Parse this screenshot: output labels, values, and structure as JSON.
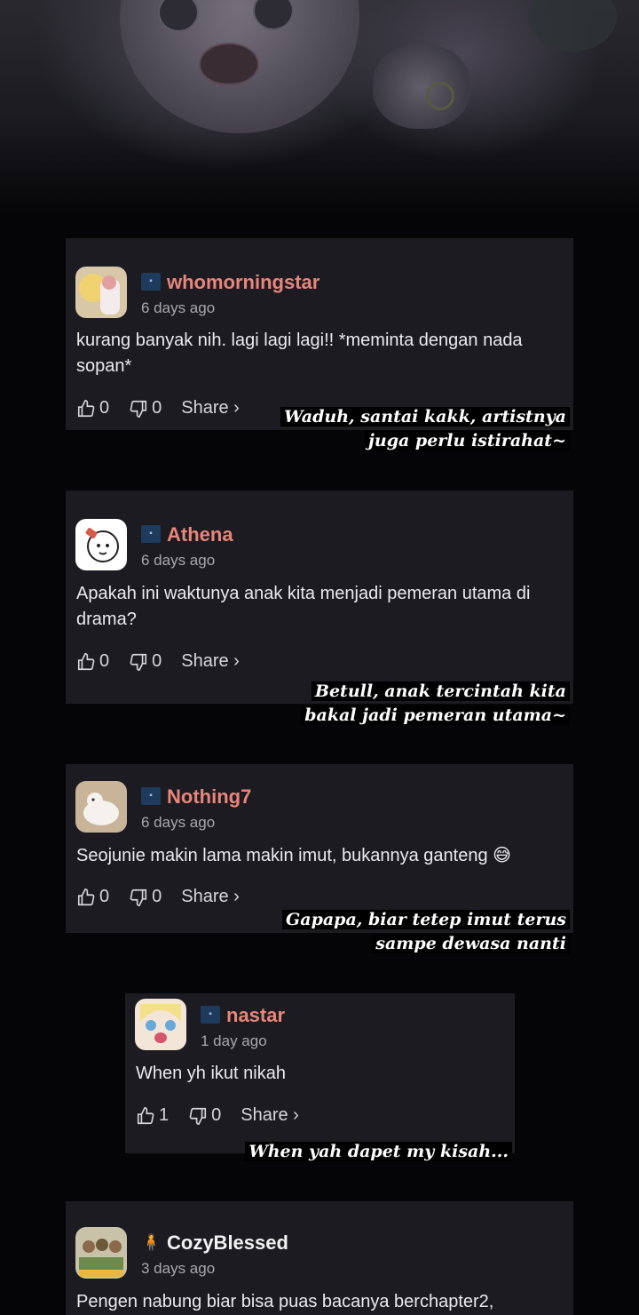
{
  "comments": [
    {
      "username": "whomorningstar",
      "time": "6 days ago",
      "text": "kurang banyak nih. lagi lagi lagi!! *meminta dengan nada sopan*",
      "likes": "0",
      "dislikes": "0",
      "share": "Share ›",
      "note_line1": "Waduh, santai kakk, artistnya",
      "note_line2": "juga perlu istirahat~"
    },
    {
      "username": "Athena",
      "time": "6 days ago",
      "text": "Apakah ini waktunya anak kita menjadi pemeran utama di drama?",
      "likes": "0",
      "dislikes": "0",
      "share": "Share ›",
      "note_line1": "Betull, anak tercintah kita",
      "note_line2": "bakal jadi pemeran utama~"
    },
    {
      "username": "Nothing7",
      "time": "6 days ago",
      "text": "Seojunie makin lama makin imut, bukannya ganteng 😅",
      "likes": "0",
      "dislikes": "0",
      "share": "Share ›",
      "note_line1": "Gapapa, biar tetep imut terus",
      "note_line2": "sampe dewasa nanti"
    },
    {
      "username": "nastar",
      "time": "1 day ago",
      "text": "When yh ikut nikah",
      "likes": "1",
      "dislikes": "0",
      "share": "Share ›",
      "note_line1": "When yah dapet my kisah..."
    },
    {
      "username": "CozyBlessed",
      "time": "3 days ago",
      "text": "Pengen nabung biar bisa puas bacanya berchapter2,"
    }
  ],
  "icons": {
    "like": "thumbs-up-icon",
    "dislike": "thumbs-down-icon",
    "badge": "blue-square-badge-icon",
    "person_badge": "person-badge-icon"
  },
  "colors": {
    "username": "#e9857a",
    "username_alt": "#f2f2f2",
    "card_bg": "#1b1b21",
    "page_bg": "#050507"
  }
}
